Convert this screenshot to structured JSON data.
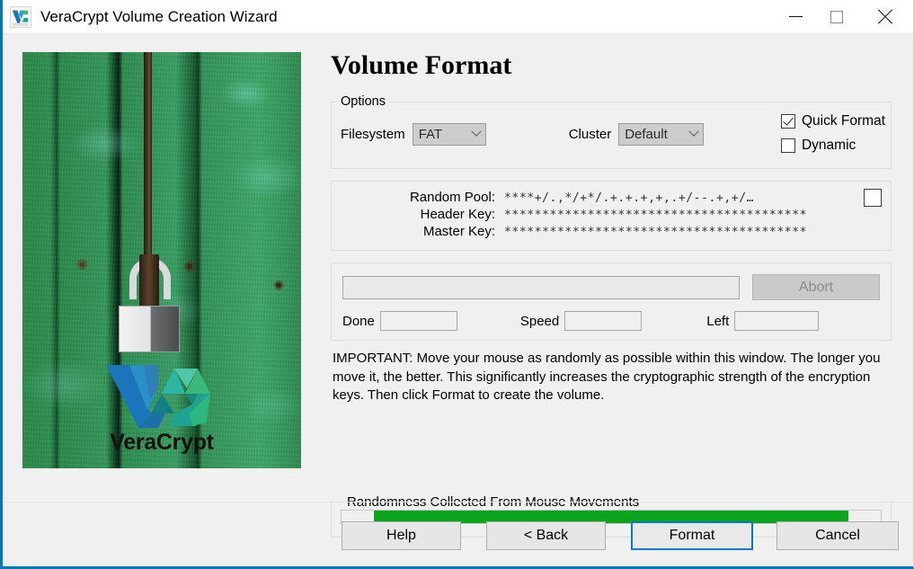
{
  "window": {
    "title": "VeraCrypt Volume Creation Wizard",
    "icon": "veracrypt-icon",
    "minimize_label": "Minimize",
    "maximize_label": "Maximize",
    "close_label": "Close",
    "accent_color": "#0078b7"
  },
  "sidebar": {
    "image_alt": "Padlock on green wooden door",
    "logo_text_first": "Vera",
    "logo_text_second": "Crypt",
    "logo_colors": {
      "v_blue": "#1b75bb",
      "c_teal": "#1aa69a",
      "c_green": "#3cb878"
    }
  },
  "page": {
    "heading": "Volume Format"
  },
  "options": {
    "legend": "Options",
    "filesystem_label": "Filesystem",
    "filesystem_value": "FAT",
    "cluster_label": "Cluster",
    "cluster_value": "Default",
    "quick_format_label": "Quick Format",
    "quick_format_checked": true,
    "dynamic_label": "Dynamic",
    "dynamic_checked": false
  },
  "keys": {
    "random_pool_label": "Random Pool:",
    "random_pool_value": "****+/.,*/+*/.+.+.+,+,.+/--.+,+/…",
    "header_key_label": "Header Key:",
    "header_key_value": "****************************************",
    "master_key_label": "Master Key:",
    "master_key_value": "****************************************",
    "display_keys_checked": false
  },
  "progress": {
    "bar_percent": 0,
    "abort_label": "Abort",
    "abort_enabled": false,
    "done_label": "Done",
    "done_value": "",
    "speed_label": "Speed",
    "speed_value": "",
    "left_label": "Left",
    "left_value": ""
  },
  "important_text": "IMPORTANT: Move your mouse as randomly as possible within this window. The longer you move it, the better. This significantly increases the cryptographic strength of the encryption keys. Then click Format to create the volume.",
  "randomness": {
    "legend": "Randomness Collected From Mouse Movements",
    "fill_percent": 88,
    "fill_color": "#0aa41d"
  },
  "footer": {
    "help_label": "Help",
    "back_label": "< Back",
    "format_label": "Format",
    "cancel_label": "Cancel",
    "focus_color": "#0078d7"
  }
}
